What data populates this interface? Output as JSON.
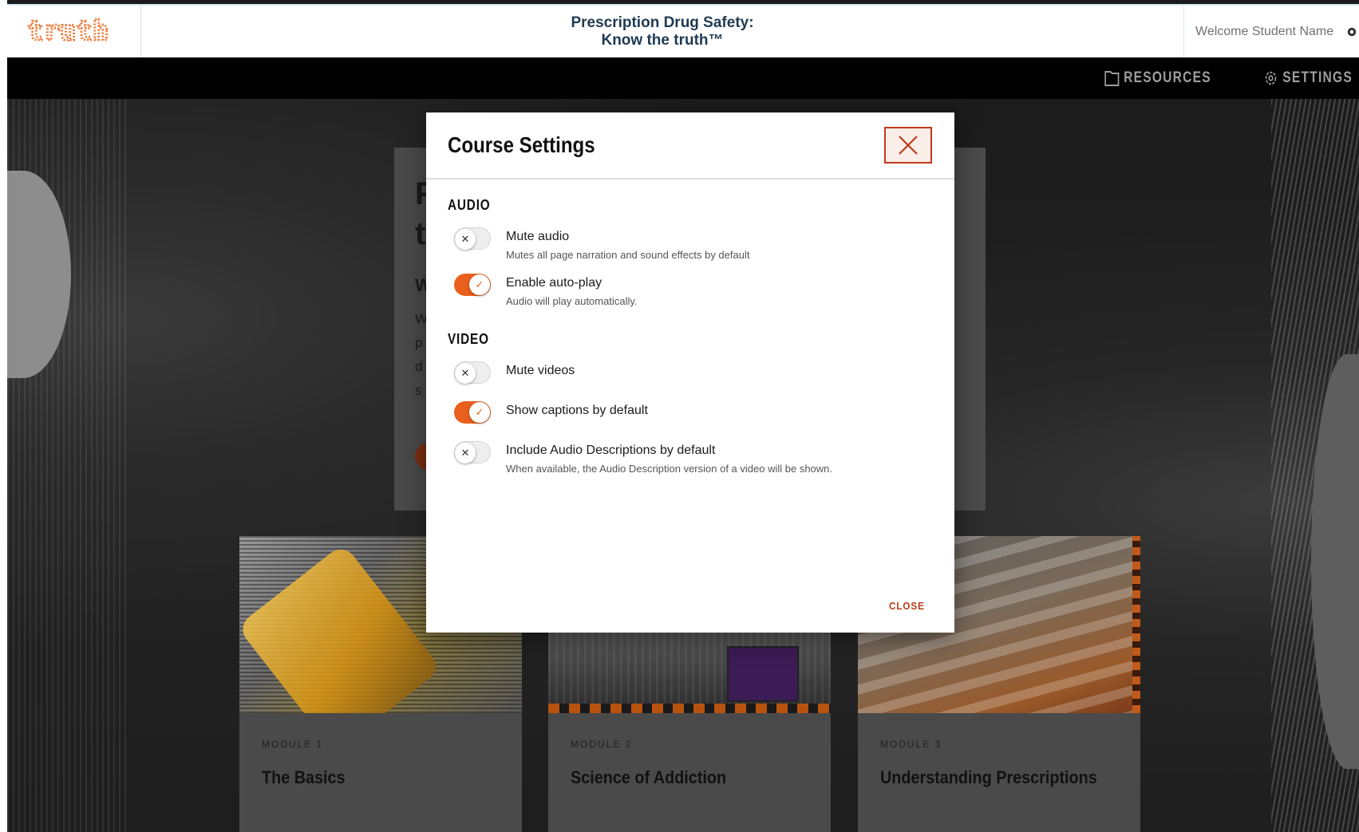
{
  "header": {
    "logo_text": "truth",
    "title_line1": "Prescription Drug Safety:",
    "title_line2": "Know the truth™",
    "welcome": "Welcome Student Name"
  },
  "nav": {
    "resources_label": "RESOURCES",
    "settings_label": "SETTINGS"
  },
  "hero": {
    "frag1": "F",
    "frag2": "t",
    "frag3": "W",
    "frag4": "W",
    "frag5": "p",
    "frag6": "d",
    "frag7": "s"
  },
  "modules": [
    {
      "kicker": "MODULE 1",
      "title": "The Basics"
    },
    {
      "kicker": "MODULE 2",
      "title": "Science of Addiction"
    },
    {
      "kicker": "MODULE 3",
      "title": "Understanding Prescriptions"
    }
  ],
  "modal": {
    "title": "Course Settings",
    "close_link": "CLOSE",
    "sections": {
      "audio": {
        "label": "AUDIO",
        "items": [
          {
            "label": "Mute audio",
            "description": "Mutes all page narration and sound effects by default",
            "enabled": false
          },
          {
            "label": "Enable auto-play",
            "description": "Audio will play automatically.",
            "enabled": true
          }
        ]
      },
      "video": {
        "label": "VIDEO",
        "items": [
          {
            "label": "Mute videos",
            "description": "",
            "enabled": false
          },
          {
            "label": "Show captions by default",
            "description": "",
            "enabled": true
          },
          {
            "label": "Include Audio Descriptions by default",
            "description": "When available, the Audio Description version of a video will be shown.",
            "enabled": false
          }
        ]
      }
    }
  },
  "colors": {
    "accent": "#e8601c",
    "close_red": "#c0391a",
    "title_navy": "#1f3a52"
  },
  "icons": {
    "resources": "folder-icon",
    "settings": "gear-icon",
    "close": "close-icon",
    "toggle_off": "x-mark",
    "toggle_on": "check-mark"
  }
}
